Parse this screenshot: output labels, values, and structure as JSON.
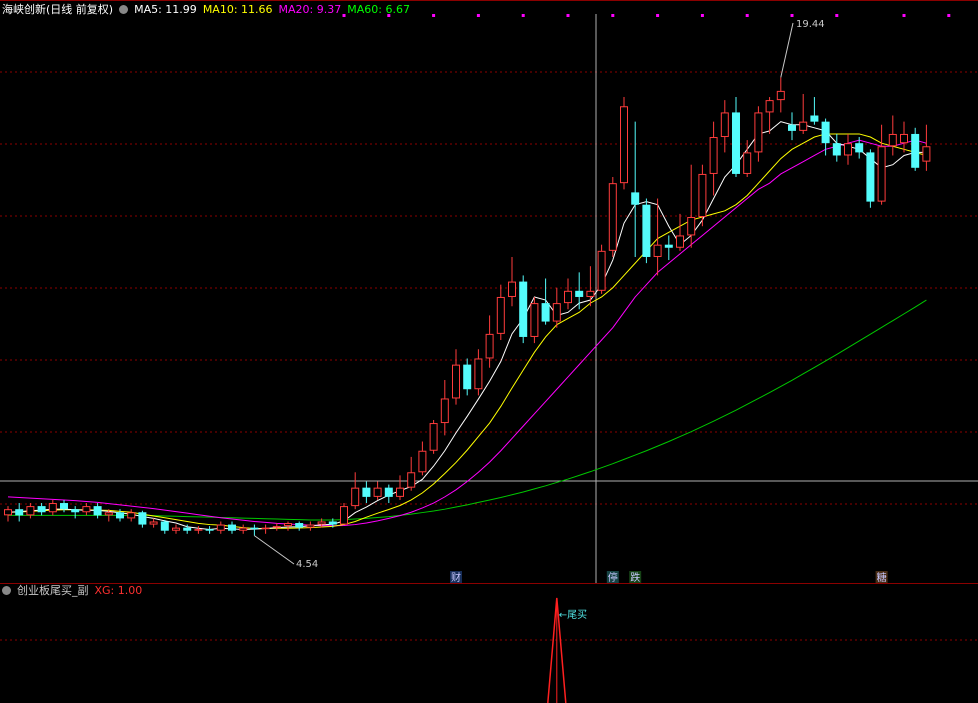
{
  "header": {
    "symbol": "海峡创新(日线 前复权)",
    "ma5": "MA5: 11.99",
    "ma10": "MA10: 11.66",
    "ma20": "MA20: 9.37",
    "ma60": "MA60: 6.67"
  },
  "indicator": {
    "name": "创业板尾买_副",
    "value": "XG: 1.00",
    "signal_label": "←尾买"
  },
  "event_labels": [
    "财",
    "停",
    "跌",
    "糖"
  ],
  "colors": {
    "up": "#ff3c3c",
    "down": "#54fcfc",
    "ma5": "#ffffff",
    "ma10": "#ffff00",
    "ma20": "#ff00ff",
    "ma60": "#00c800",
    "grid": "#8b0000",
    "signal": "#ff2020"
  },
  "chart_data": {
    "type": "candlestick",
    "y_range": [
      3.0,
      21.5
    ],
    "annotations": {
      "high": "19.44",
      "low": "4.54"
    },
    "candles": [
      [
        5.2,
        5.4,
        5.5,
        5.0
      ],
      [
        5.4,
        5.2,
        5.6,
        5.0
      ],
      [
        5.2,
        5.5,
        5.6,
        5.1
      ],
      [
        5.5,
        5.3,
        5.6,
        5.2
      ],
      [
        5.3,
        5.6,
        5.7,
        5.2
      ],
      [
        5.6,
        5.4,
        5.7,
        5.3
      ],
      [
        5.4,
        5.3,
        5.5,
        5.1
      ],
      [
        5.3,
        5.5,
        5.6,
        5.2
      ],
      [
        5.5,
        5.2,
        5.6,
        5.1
      ],
      [
        5.2,
        5.3,
        5.4,
        5.0
      ],
      [
        5.3,
        5.1,
        5.4,
        5.0
      ],
      [
        5.1,
        5.3,
        5.4,
        5.0
      ],
      [
        5.3,
        4.9,
        5.35,
        4.8
      ],
      [
        4.9,
        5.0,
        5.1,
        4.8
      ],
      [
        5.0,
        4.7,
        5.05,
        4.6
      ],
      [
        4.7,
        4.8,
        4.9,
        4.6
      ],
      [
        4.8,
        4.7,
        4.9,
        4.6
      ],
      [
        4.7,
        4.75,
        4.85,
        4.6
      ],
      [
        4.75,
        4.7,
        4.85,
        4.6
      ],
      [
        4.7,
        4.9,
        5.0,
        4.6
      ],
      [
        4.9,
        4.7,
        5.0,
        4.6
      ],
      [
        4.7,
        4.8,
        4.9,
        4.6
      ],
      [
        4.8,
        4.75,
        4.9,
        4.54
      ],
      [
        4.75,
        4.8,
        4.9,
        4.6
      ],
      [
        4.8,
        4.85,
        4.95,
        4.7
      ],
      [
        4.85,
        4.95,
        5.0,
        4.7
      ],
      [
        4.95,
        4.8,
        5.0,
        4.7
      ],
      [
        4.8,
        4.9,
        5.0,
        4.7
      ],
      [
        4.9,
        5.0,
        5.1,
        4.8
      ],
      [
        5.0,
        4.9,
        5.1,
        4.8
      ],
      [
        4.9,
        5.5,
        5.6,
        4.9
      ],
      [
        5.5,
        6.1,
        6.6,
        5.4
      ],
      [
        6.1,
        5.8,
        6.3,
        5.6
      ],
      [
        5.8,
        6.1,
        6.3,
        5.7
      ],
      [
        6.1,
        5.8,
        6.2,
        5.6
      ],
      [
        5.8,
        6.1,
        6.5,
        5.7
      ],
      [
        6.1,
        6.6,
        7.1,
        6.0
      ],
      [
        6.6,
        7.3,
        7.6,
        6.5
      ],
      [
        7.3,
        8.2,
        8.3,
        7.2
      ],
      [
        8.2,
        9.0,
        9.6,
        7.8
      ],
      [
        9.0,
        10.1,
        10.6,
        8.8
      ],
      [
        10.1,
        9.3,
        10.3,
        9.1
      ],
      [
        9.3,
        10.3,
        10.6,
        9.1
      ],
      [
        10.3,
        11.1,
        11.7,
        10.0
      ],
      [
        11.1,
        12.3,
        12.7,
        10.9
      ],
      [
        12.3,
        12.8,
        13.6,
        12.0
      ],
      [
        12.8,
        11.0,
        13.0,
        10.8
      ],
      [
        11.0,
        12.1,
        12.3,
        10.8
      ],
      [
        12.1,
        11.5,
        12.9,
        11.4
      ],
      [
        11.5,
        12.1,
        12.6,
        11.3
      ],
      [
        12.1,
        12.5,
        12.9,
        11.9
      ],
      [
        12.5,
        12.3,
        13.1,
        11.9
      ],
      [
        12.3,
        12.5,
        13.3,
        12.0
      ],
      [
        12.5,
        13.8,
        14.0,
        12.4
      ],
      [
        13.8,
        16.0,
        16.2,
        13.6
      ],
      [
        16.0,
        18.5,
        18.8,
        15.8
      ],
      [
        15.7,
        15.3,
        18.0,
        13.6
      ],
      [
        15.3,
        13.6,
        15.5,
        13.4
      ],
      [
        13.6,
        14.0,
        15.5,
        13.0
      ],
      [
        14.0,
        13.9,
        14.3,
        13.5
      ],
      [
        13.9,
        14.3,
        15.0,
        13.8
      ],
      [
        14.3,
        14.9,
        16.6,
        13.9
      ],
      [
        14.9,
        16.3,
        16.6,
        14.6
      ],
      [
        16.3,
        17.5,
        18.0,
        15.6
      ],
      [
        17.5,
        18.3,
        18.7,
        17.0
      ],
      [
        18.3,
        16.3,
        18.8,
        16.2
      ],
      [
        16.3,
        17.0,
        17.4,
        16.2
      ],
      [
        17.0,
        18.3,
        18.5,
        16.7
      ],
      [
        18.3,
        18.7,
        18.8,
        17.6
      ],
      [
        18.7,
        19.0,
        19.44,
        18.3
      ],
      [
        17.9,
        17.7,
        18.3,
        17.4
      ],
      [
        17.7,
        18.0,
        18.9,
        17.6
      ],
      [
        18.2,
        18.0,
        18.8,
        17.9
      ],
      [
        18.0,
        17.3,
        18.1,
        16.9
      ],
      [
        17.3,
        16.9,
        17.6,
        16.7
      ],
      [
        16.9,
        17.3,
        17.6,
        16.6
      ],
      [
        17.3,
        17.0,
        17.5,
        16.8
      ],
      [
        17.0,
        15.4,
        17.1,
        15.2
      ],
      [
        15.4,
        17.2,
        17.9,
        15.3
      ],
      [
        17.2,
        17.6,
        18.2,
        16.9
      ],
      [
        17.3,
        17.6,
        18.0,
        17.0
      ],
      [
        17.6,
        16.5,
        17.8,
        16.4
      ],
      [
        16.7,
        17.2,
        17.9,
        16.4
      ]
    ],
    "ma5": [
      5.3,
      5.32,
      5.35,
      5.37,
      5.4,
      5.4,
      5.38,
      5.36,
      5.36,
      5.33,
      5.28,
      5.24,
      5.16,
      5.1,
      5.02,
      4.95,
      4.83,
      4.78,
      4.74,
      4.78,
      4.76,
      4.74,
      4.75,
      4.77,
      4.8,
      4.82,
      4.83,
      4.86,
      4.89,
      4.91,
      5.02,
      5.29,
      5.47,
      5.68,
      5.86,
      6.0,
      6.14,
      6.37,
      6.8,
      7.3,
      7.88,
      8.42,
      8.98,
      9.56,
      10.2,
      11.1,
      11.6,
      12.3,
      12.2,
      11.7,
      11.8,
      12.1,
      12.2,
      12.7,
      13.5,
      14.7,
      15.3,
      15.4,
      15.3,
      14.6,
      14.0,
      14.3,
      14.8,
      15.5,
      16.2,
      16.6,
      17.1,
      17.6,
      17.7,
      18.0,
      17.9,
      17.9,
      17.8,
      17.7,
      17.3,
      17.2,
      17.1,
      16.8,
      16.5,
      16.6,
      16.9,
      17.0,
      17.0
    ],
    "ma10": [
      5.3,
      5.31,
      5.33,
      5.35,
      5.37,
      5.38,
      5.38,
      5.38,
      5.37,
      5.36,
      5.33,
      5.3,
      5.24,
      5.18,
      5.12,
      5.06,
      5.0,
      4.94,
      4.9,
      4.88,
      4.84,
      4.8,
      4.77,
      4.77,
      4.78,
      4.78,
      4.79,
      4.8,
      4.82,
      4.84,
      4.9,
      5.0,
      5.14,
      5.27,
      5.39,
      5.52,
      5.7,
      5.93,
      6.22,
      6.56,
      6.92,
      7.32,
      7.76,
      8.2,
      8.74,
      9.34,
      9.92,
      10.5,
      11.0,
      11.4,
      11.6,
      11.8,
      12.1,
      12.3,
      12.6,
      13.0,
      13.4,
      13.8,
      14.2,
      14.4,
      14.6,
      14.8,
      14.9,
      15.0,
      15.1,
      15.3,
      15.6,
      16.0,
      16.4,
      16.8,
      17.1,
      17.3,
      17.5,
      17.6,
      17.6,
      17.6,
      17.6,
      17.5,
      17.3,
      17.2,
      17.1,
      17.0,
      16.9
    ],
    "ma20": [
      5.8,
      5.78,
      5.76,
      5.74,
      5.72,
      5.7,
      5.68,
      5.65,
      5.62,
      5.58,
      5.54,
      5.5,
      5.46,
      5.42,
      5.37,
      5.32,
      5.27,
      5.22,
      5.17,
      5.12,
      5.08,
      5.04,
      5.0,
      4.97,
      4.94,
      4.92,
      4.9,
      4.88,
      4.86,
      4.86,
      4.87,
      4.9,
      4.95,
      5.02,
      5.1,
      5.19,
      5.3,
      5.44,
      5.6,
      5.8,
      6.03,
      6.3,
      6.6,
      6.93,
      7.3,
      7.7,
      8.1,
      8.5,
      8.9,
      9.3,
      9.7,
      10.1,
      10.5,
      10.9,
      11.3,
      11.8,
      12.3,
      12.7,
      13.1,
      13.4,
      13.7,
      14.0,
      14.3,
      14.6,
      14.9,
      15.2,
      15.5,
      15.8,
      16.0,
      16.3,
      16.5,
      16.7,
      16.9,
      17.1,
      17.2,
      17.3,
      17.4,
      17.3,
      17.2,
      17.2,
      17.3,
      17.4,
      17.3
    ],
    "ma60": [
      5.2,
      5.2,
      5.2,
      5.2,
      5.2,
      5.2,
      5.2,
      5.2,
      5.2,
      5.2,
      5.2,
      5.2,
      5.2,
      5.19,
      5.18,
      5.17,
      5.16,
      5.15,
      5.14,
      5.13,
      5.12,
      5.11,
      5.1,
      5.09,
      5.08,
      5.07,
      5.06,
      5.05,
      5.05,
      5.05,
      5.06,
      5.08,
      5.1,
      5.13,
      5.16,
      5.2,
      5.24,
      5.29,
      5.34,
      5.4,
      5.47,
      5.54,
      5.62,
      5.7,
      5.78,
      5.87,
      5.96,
      6.06,
      6.16,
      6.27,
      6.38,
      6.5,
      6.62,
      6.75,
      6.88,
      7.02,
      7.16,
      7.3,
      7.45,
      7.6,
      7.76,
      7.92,
      8.09,
      8.26,
      8.44,
      8.62,
      8.81,
      9.0,
      9.19,
      9.39,
      9.59,
      9.8,
      10.01,
      10.22,
      10.43,
      10.65,
      10.87,
      11.09,
      11.31,
      11.53,
      11.75,
      11.97,
      12.2
    ],
    "signal": {
      "index": 49,
      "value": 1.0
    }
  }
}
